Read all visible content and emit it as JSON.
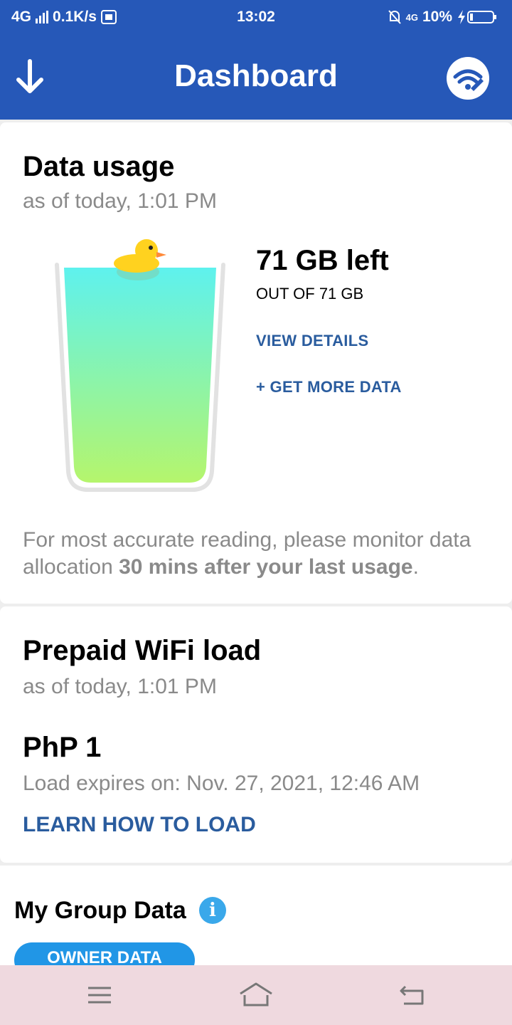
{
  "status_bar": {
    "network": "4G",
    "speed": "0.1K/s",
    "time": "13:02",
    "mobile_data": "4G",
    "battery": "10%"
  },
  "app_bar": {
    "title": "Dashboard",
    "back_icon": "arrow-down-icon",
    "action_icon": "wifi-tool-icon"
  },
  "data_usage": {
    "title": "Data usage",
    "as_of": "as of today, 1:01 PM",
    "remaining": "71 GB left",
    "total": "OUT OF 71 GB",
    "view_details": "VIEW DETAILS",
    "get_more": "+ GET MORE DATA",
    "fill_fraction": 1.0,
    "note_prefix": "For most accurate reading, please monitor data allocation ",
    "note_bold": "30 mins after your last usage",
    "note_suffix": "."
  },
  "prepaid": {
    "title": "Prepaid WiFi load",
    "as_of": "as of today, 1:01 PM",
    "balance": "PhP 1",
    "expires": "Load expires on: Nov. 27, 2021, 12:46 AM",
    "learn_link": "LEARN HOW TO LOAD"
  },
  "group_data": {
    "title": "My Group Data",
    "info_glyph": "i",
    "chip_label": "OWNER DATA"
  },
  "colors": {
    "brand_blue": "#2658b8",
    "link_blue": "#2a5c9e",
    "chip_blue": "#2196e6",
    "water_top": "#5ef2ee",
    "water_bottom": "#b5f56c"
  },
  "nav": {
    "menu_icon": "menu-icon",
    "home_icon": "home-icon",
    "back_icon": "back-icon"
  }
}
